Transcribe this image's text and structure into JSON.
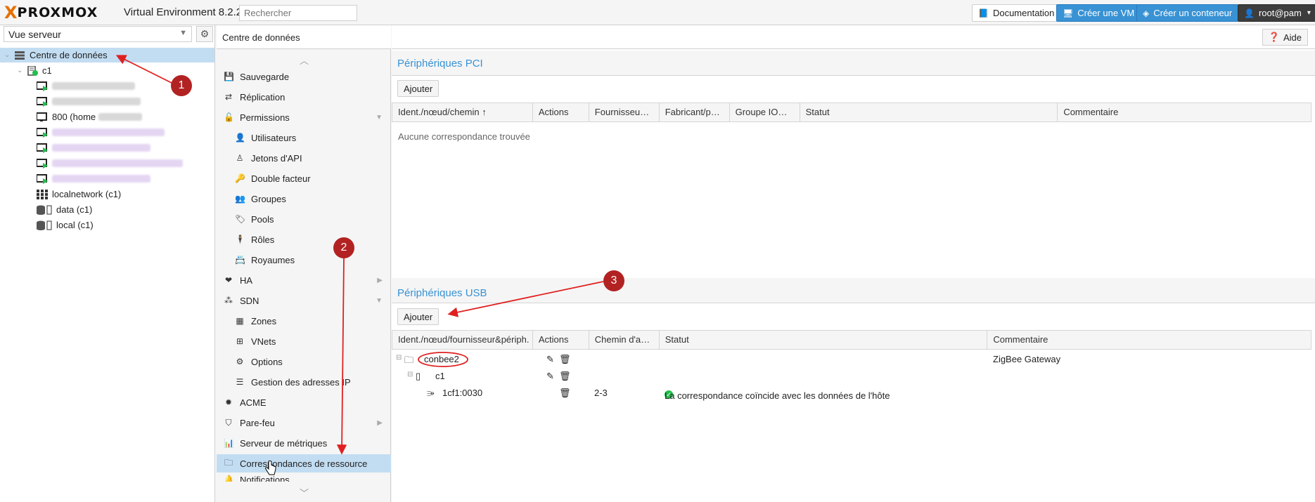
{
  "topbar": {
    "logo_x": "X",
    "logo_text": "PROXMOX",
    "version": "Virtual Environment 8.2.2",
    "search_placeholder": "Rechercher",
    "documentation": "Documentation",
    "create_vm": "Créer une VM",
    "create_ct": "Créer un conteneur",
    "user": "root@pam"
  },
  "sidebar": {
    "view": "Vue serveur",
    "tree": [
      {
        "label": "Centre de données"
      },
      {
        "label": "c1"
      },
      {
        "label": "800 (home"
      },
      {
        "label": "localnetwork (c1)"
      },
      {
        "label": "data (c1)"
      },
      {
        "label": "local (c1)"
      }
    ]
  },
  "menu": {
    "header": "Centre de données",
    "items": [
      {
        "label": "Sauvegarde",
        "icon": "floppy-icon"
      },
      {
        "label": "Réplication",
        "icon": "retweet-icon"
      },
      {
        "label": "Permissions",
        "icon": "unlock-icon"
      },
      {
        "label": "Utilisateurs",
        "icon": "user-icon"
      },
      {
        "label": "Jetons d'API",
        "icon": "user-outline-icon"
      },
      {
        "label": "Double facteur",
        "icon": "key-icon"
      },
      {
        "label": "Groupes",
        "icon": "users-icon"
      },
      {
        "label": "Pools",
        "icon": "tags-icon"
      },
      {
        "label": "Rôles",
        "icon": "male-icon"
      },
      {
        "label": "Royaumes",
        "icon": "address-book-icon"
      },
      {
        "label": "HA",
        "icon": "heartbeat-icon"
      },
      {
        "label": "SDN",
        "icon": "sdn-icon"
      },
      {
        "label": "Zones",
        "icon": "th-icon"
      },
      {
        "label": "VNets",
        "icon": "sitemap-icon"
      },
      {
        "label": "Options",
        "icon": "gear-icon"
      },
      {
        "label": "Gestion des adresses IP",
        "icon": "ipam-icon"
      },
      {
        "label": "ACME",
        "icon": "certificate-icon"
      },
      {
        "label": "Pare-feu",
        "icon": "shield-icon"
      },
      {
        "label": "Serveur de métriques",
        "icon": "bar-chart-icon"
      },
      {
        "label": "Correspondances de ressource",
        "icon": "folder-icon"
      },
      {
        "label": "Notifications",
        "icon": "bell-icon"
      }
    ]
  },
  "main": {
    "header": "Centre de données",
    "help": "Aide",
    "pci": {
      "title": "Périphériques PCI",
      "add": "Ajouter",
      "columns": [
        "Ident./nœud/chemin ↑",
        "Actions",
        "Fournisseu…",
        "Fabricant/p…",
        "Groupe IO…",
        "Statut",
        "Commentaire"
      ],
      "empty": "Aucune correspondance trouvée"
    },
    "usb": {
      "title": "Périphériques USB",
      "add": "Ajouter",
      "columns": [
        "Ident./nœud/fournisseur&périph.",
        "Actions",
        "Chemin d'a…",
        "Statut",
        "Commentaire"
      ],
      "rows": [
        {
          "name": "conbee2",
          "path": "",
          "status": "",
          "comment": "ZigBee Gateway"
        },
        {
          "name": "c1",
          "path": "",
          "status": "",
          "comment": ""
        },
        {
          "name": "1cf1:0030",
          "path": "2-3",
          "status": "La correspondance coïncide avec les données de l'hôte",
          "comment": ""
        }
      ]
    }
  },
  "annotations": [
    "1",
    "2",
    "3"
  ],
  "colors": {
    "accent": "#3892d4",
    "annotation": "#b22222",
    "selection": "#c2ddf2",
    "ok": "#21bf4b"
  }
}
